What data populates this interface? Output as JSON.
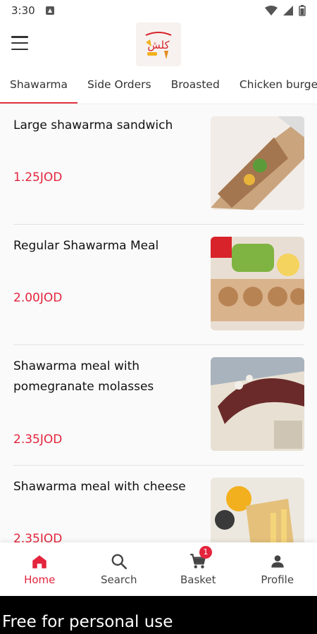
{
  "status_bar": {
    "time": "3:30"
  },
  "header": {
    "menu_icon": "hamburger-menu-icon",
    "logo_text": "شاورما كلش"
  },
  "tabs": [
    {
      "label": "Shawarma",
      "active": true
    },
    {
      "label": "Side Orders",
      "active": false
    },
    {
      "label": "Broasted",
      "active": false
    },
    {
      "label": "Chicken burger s",
      "active": false
    }
  ],
  "items": [
    {
      "name": "Large shawarma sandwich",
      "price": "1.25JOD"
    },
    {
      "name": "Regular Shawarma Meal",
      "price": "2.00JOD"
    },
    {
      "name": "Shawarma meal with pomegranate molasses",
      "price": "2.35JOD"
    },
    {
      "name": "Shawarma meal with cheese",
      "price": "2.35JOD"
    }
  ],
  "bottom_nav": {
    "home": {
      "label": "Home",
      "icon": "home-icon"
    },
    "search": {
      "label": "Search",
      "icon": "search-icon"
    },
    "basket": {
      "label": "Basket",
      "icon": "cart-icon",
      "badge": "1"
    },
    "profile": {
      "label": "Profile",
      "icon": "profile-icon"
    }
  },
  "footer": {
    "text": "Free for personal use"
  },
  "colors": {
    "accent": "#e3243c",
    "text": "#111111",
    "background": "#fafafa"
  }
}
